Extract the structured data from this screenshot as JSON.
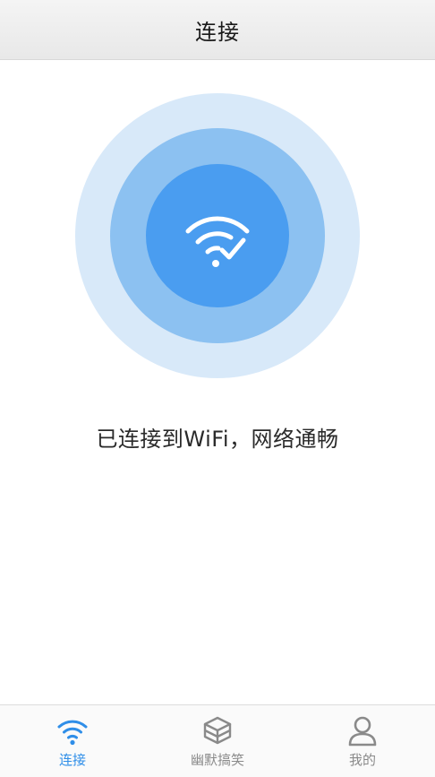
{
  "header": {
    "title": "连接"
  },
  "status": {
    "message": "已连接到WiFi，网络通畅"
  },
  "icons": {
    "center": "wifi-check-icon",
    "tabs": [
      "wifi-icon",
      "cube-stack-icon",
      "user-icon"
    ]
  },
  "colors": {
    "accent": "#2f8ee8",
    "ring_outer": "#d8e9f9",
    "ring_middle": "#8cc1f1",
    "ring_inner": "#4a9df0",
    "tab_inactive": "#8a8a8a"
  },
  "tabbar": {
    "tabs": [
      {
        "label": "连接",
        "active": true
      },
      {
        "label": "幽默搞笑",
        "active": false
      },
      {
        "label": "我的",
        "active": false
      }
    ]
  }
}
